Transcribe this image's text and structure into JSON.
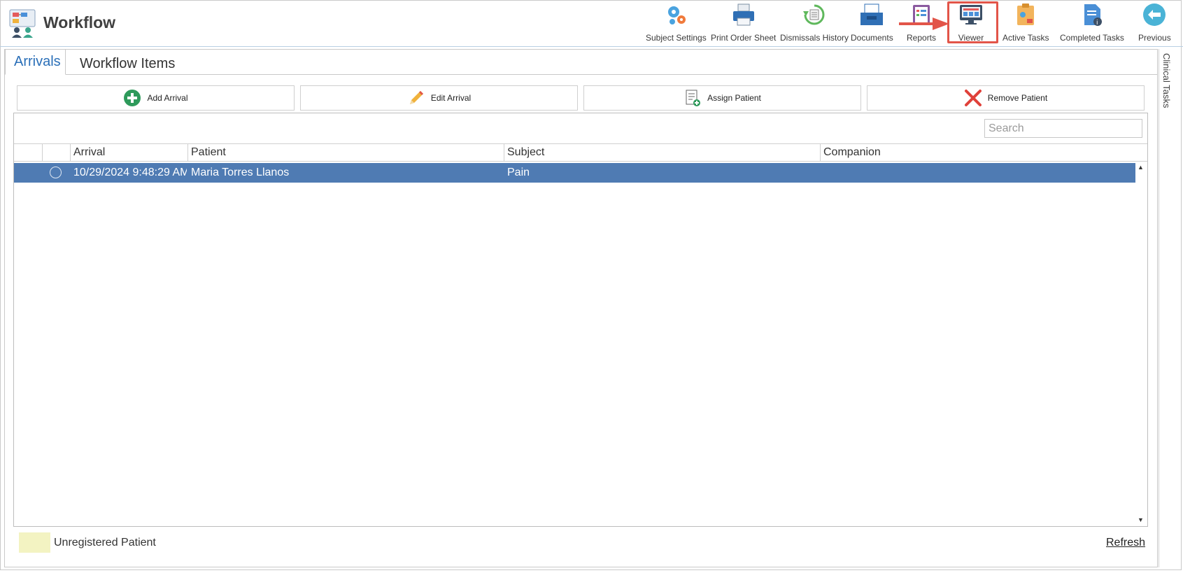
{
  "app": {
    "title": "Workflow"
  },
  "toolbar": {
    "subject_settings": "Subject Settings",
    "print_order_sheet": "Print Order Sheet",
    "dismissals_history": "Dismissals History",
    "documents": "Documents",
    "reports": "Reports",
    "viewer": "Viewer",
    "active_tasks": "Active Tasks",
    "completed_tasks": "Completed Tasks",
    "previous": "Previous"
  },
  "tabs": {
    "arrivals": "Arrivals",
    "workflow_items": "Workflow Items"
  },
  "side_panel": {
    "label": "Clinical Tasks"
  },
  "actions": {
    "add_arrival": "Add Arrival",
    "edit_arrival": "Edit Arrival",
    "assign_patient": "Assign Patient",
    "remove_patient": "Remove Patient"
  },
  "search": {
    "placeholder": "Search",
    "value": ""
  },
  "grid": {
    "columns": {
      "arrival": "Arrival",
      "patient": "Patient",
      "subject": "Subject",
      "companion": "Companion"
    },
    "rows": [
      {
        "arrival": "10/29/2024 9:48:29 AM",
        "patient": "Maria Torres Llanos",
        "subject": "Pain",
        "companion": ""
      }
    ]
  },
  "legend": {
    "unregistered": "Unregistered Patient"
  },
  "footer": {
    "refresh": "Refresh"
  },
  "colors": {
    "selected_row": "#4f7bb3",
    "active_tab": "#2a6fb8",
    "highlight": "#e25549",
    "unregistered_swatch": "#f3f3c2"
  }
}
